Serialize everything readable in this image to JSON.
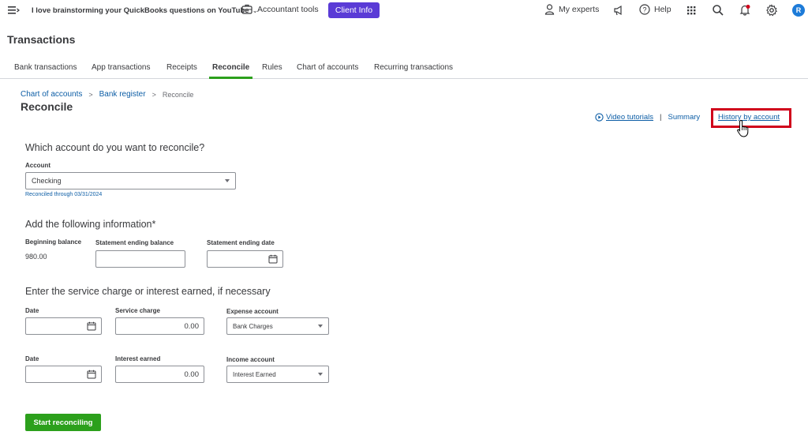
{
  "topbar": {
    "company_name": "I love brainstorming your QuickBooks questions on YouTube",
    "accountant_tools": "Accountant tools",
    "client_info": "Client Info",
    "my_experts": "My experts",
    "help": "Help",
    "avatar_initial": "R"
  },
  "page_title": "Transactions",
  "tabs": [
    {
      "label": "Bank transactions"
    },
    {
      "label": "App transactions"
    },
    {
      "label": "Receipts"
    },
    {
      "label": "Reconcile",
      "active": true
    },
    {
      "label": "Rules"
    },
    {
      "label": "Chart of accounts"
    },
    {
      "label": "Recurring transactions"
    }
  ],
  "breadcrumb": {
    "items": [
      "Chart of accounts",
      "Bank register",
      "Reconcile"
    ],
    "sep": ">"
  },
  "reconcile_title": "Reconcile",
  "links": {
    "video_tutorials": "Video tutorials",
    "separator": "|",
    "summary": "Summary",
    "history_by_account": "History by account"
  },
  "account_section": {
    "title": "Which account do you want to reconcile?",
    "account_label": "Account",
    "account_value": "Checking",
    "reconciled_note": "Reconciled through 03/31/2024"
  },
  "info_section": {
    "title": "Add the following information*",
    "beginning_balance_label": "Beginning balance",
    "beginning_balance_value": "980.00",
    "statement_ending_balance_label": "Statement ending balance",
    "statement_ending_balance_value": "",
    "statement_ending_date_label": "Statement ending date",
    "statement_ending_date_value": ""
  },
  "service_section": {
    "title": "Enter the service charge or interest earned, if necessary",
    "row1": {
      "date_label": "Date",
      "date_value": "",
      "amount_label": "Service charge",
      "amount_value": "0.00",
      "account_label": "Expense account",
      "account_value": "Bank Charges"
    },
    "row2": {
      "date_label": "Date",
      "date_value": "",
      "amount_label": "Interest earned",
      "amount_value": "0.00",
      "account_label": "Income account",
      "account_value": "Interest Earned"
    }
  },
  "start_button": "Start reconciling",
  "colors": {
    "accent_green": "#2ca01c",
    "link_blue": "#0d5ea6",
    "client_btn": "#5a3bd6",
    "highlight_red": "#d0021b"
  }
}
